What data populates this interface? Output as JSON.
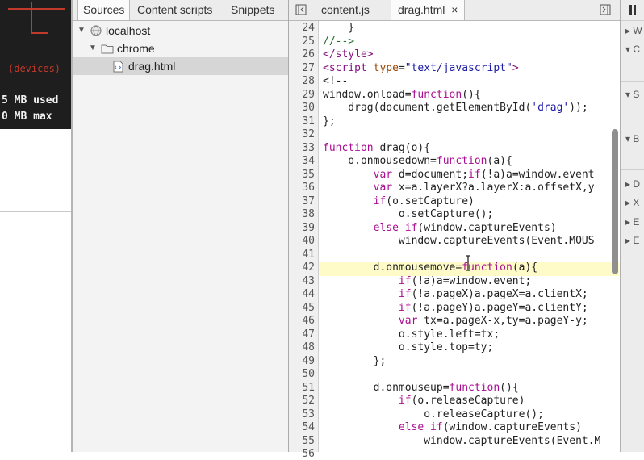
{
  "left_panel": {
    "devices_text": "(devices)",
    "memory_used": "5 MB used",
    "memory_max": "0 MB max"
  },
  "navigator": {
    "tabs": [
      {
        "label": "Sources"
      },
      {
        "label": "Content scripts"
      },
      {
        "label": "Snippets"
      }
    ],
    "tree": [
      {
        "label": "localhost"
      },
      {
        "label": "chrome"
      },
      {
        "label": "drag.html"
      }
    ]
  },
  "editor": {
    "tabs": [
      {
        "label": "content.js"
      },
      {
        "label": "drag.html"
      }
    ],
    "close_glyph": "×",
    "line_numbers": [
      "24",
      "25",
      "26",
      "27",
      "28",
      "29",
      "30",
      "31",
      "32",
      "33",
      "34",
      "35",
      "36",
      "37",
      "38",
      "39",
      "40",
      "41",
      "42",
      "43",
      "44",
      "45",
      "46",
      "47",
      "48",
      "49",
      "50",
      "51",
      "52",
      "53",
      "54",
      "55",
      "56"
    ],
    "highlighted_line": "42"
  },
  "right_panel": {
    "labels": [
      "W",
      "C",
      "S",
      "B",
      "D",
      "X",
      "E",
      "E"
    ]
  },
  "icons": {
    "toggle_nav": "sidebar-toggle-icon",
    "toggle_debug": "debugger-sidebar-toggle-icon",
    "pause": "pause-icon"
  },
  "colors": {
    "highlight": "#fffbc9",
    "keyword": "#aa0d91",
    "tag": "#881280",
    "attribute": "#994500",
    "string": "#1a1aa6",
    "comment": "#236e25"
  }
}
